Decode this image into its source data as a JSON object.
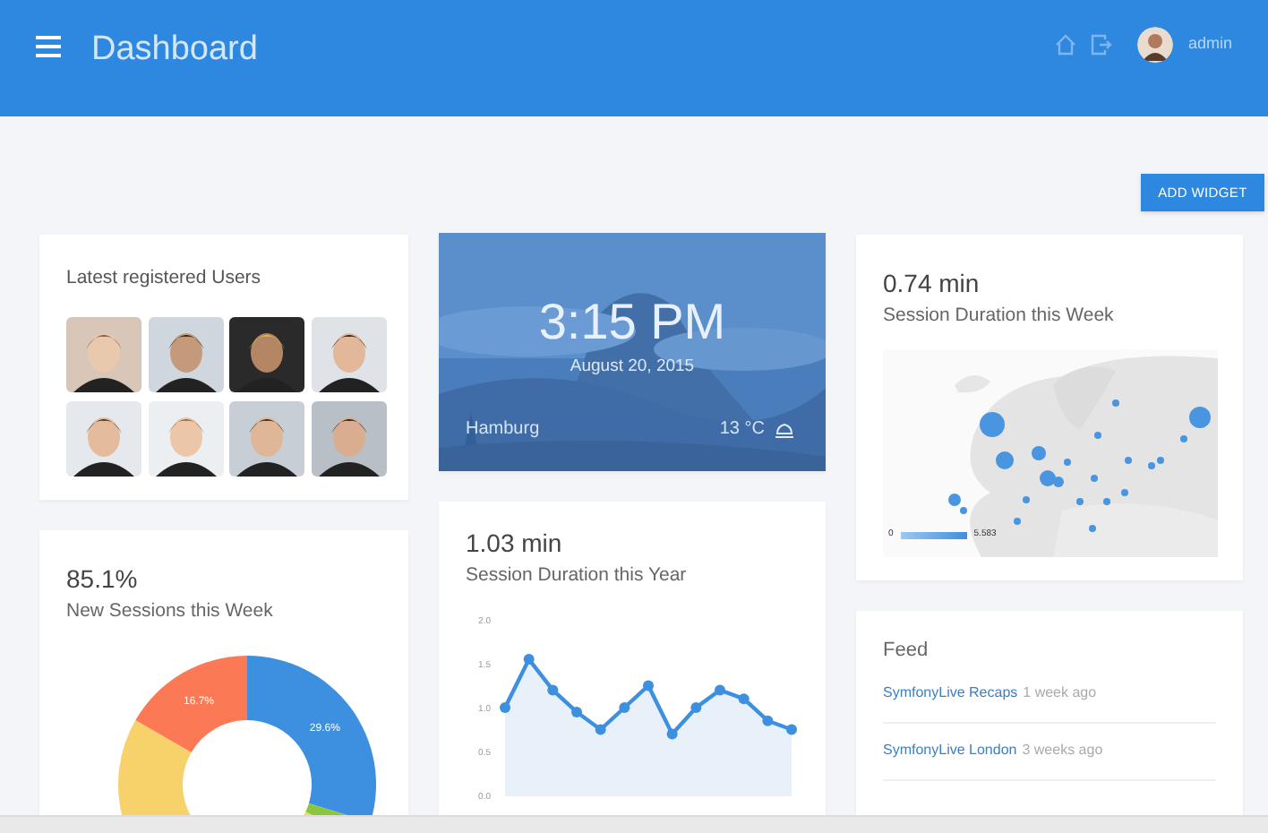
{
  "header": {
    "title": "Dashboard",
    "user": "admin"
  },
  "add_widget": "ADD WIDGET",
  "users_card": {
    "title": "Latest registered Users"
  },
  "weather": {
    "time": "3:15 PM",
    "date": "August 20, 2015",
    "city": "Hamburg",
    "temperature": "13 °C"
  },
  "week_map": {
    "value": "0.74 min",
    "label": "Session Duration this Week",
    "legend_min": "0",
    "legend_max": "5.583"
  },
  "sessions": {
    "value": "85.1%",
    "label": "New Sessions this Week",
    "slices": [
      {
        "label": "29.6%",
        "color": "#3d8fe0"
      },
      {
        "color": "#8cc63f"
      },
      {
        "color": "#f7d26a"
      },
      {
        "label": "16.7%",
        "color": "#fb7a55"
      }
    ]
  },
  "year_chart": {
    "value": "1.03 min",
    "label": "Session Duration this Year",
    "chart_data": {
      "type": "area",
      "series": [
        {
          "color": "#3d8fe0",
          "values": [
            1.0,
            1.55,
            1.2,
            0.95,
            0.75,
            1.0,
            1.25,
            0.7,
            1.0,
            1.2,
            1.1,
            0.85,
            0.75
          ]
        }
      ],
      "ylim": [
        0,
        2
      ],
      "yticks": [
        {
          "value": 0,
          "label": "0.0"
        },
        {
          "value": 0.5,
          "label": "0.5"
        },
        {
          "value": 1,
          "label": "1.0"
        },
        {
          "value": 1.5,
          "label": "1.5"
        },
        {
          "value": 2,
          "label": "2.0"
        }
      ]
    }
  },
  "feed": {
    "title": "Feed",
    "items": [
      {
        "link": "SymfonyLive Recaps",
        "time": "1 week ago"
      },
      {
        "link": "SymfonyLive London",
        "time": "3 weeks ago"
      }
    ]
  }
}
